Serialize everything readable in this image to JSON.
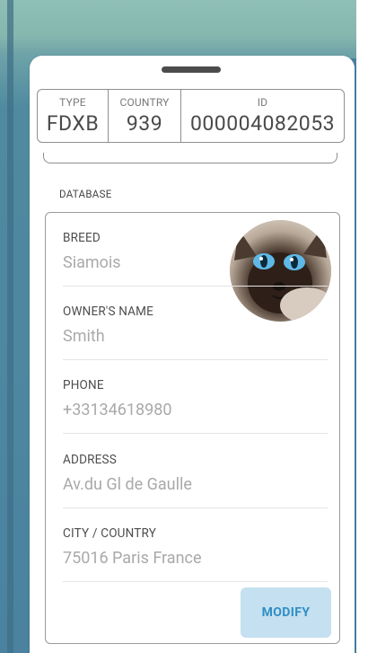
{
  "id_box": {
    "type_label": "TYPE",
    "type_value": "FDXB",
    "country_label": "COUNTRY",
    "country_value": "939",
    "id_label": "ID",
    "id_value": "000004082053"
  },
  "section_title": "DATABASE",
  "fields": [
    {
      "label": "BREED",
      "value": "Siamois"
    },
    {
      "label": "OWNER'S NAME",
      "value": "Smith"
    },
    {
      "label": "PHONE",
      "value": "+33134618980"
    },
    {
      "label": "ADDRESS",
      "value": "Av.du Gl de Gaulle"
    },
    {
      "label": "CITY / COUNTRY",
      "value": "75016 Paris France"
    }
  ],
  "modify_label": "MODIFY",
  "colors": {
    "accent": "#2f8fc5",
    "button_bg": "#c5e0f0",
    "label": "#4d4d4d",
    "value": "#a9a9a9"
  }
}
